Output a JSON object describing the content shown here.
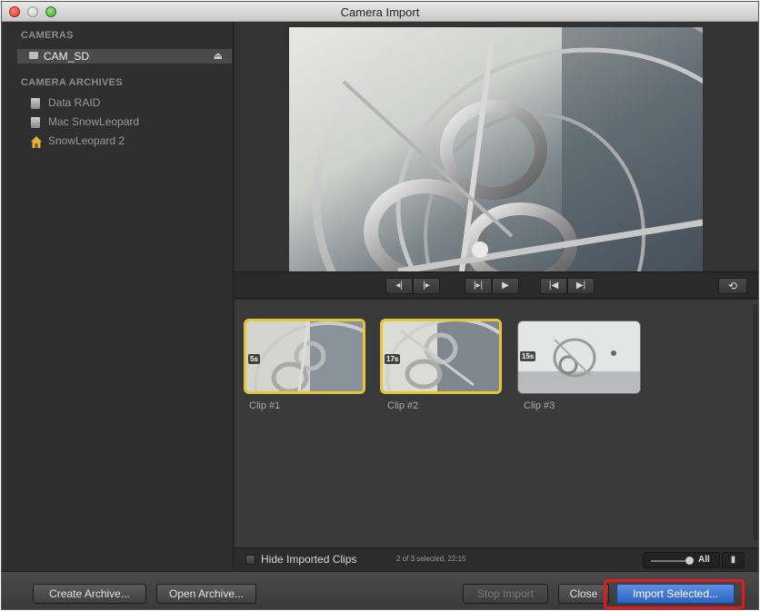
{
  "window": {
    "title": "Camera Import"
  },
  "sidebar": {
    "cameras_header": "CAMERAS",
    "cameras": [
      {
        "label": "CAM_SD",
        "icon": "camera-card-icon"
      }
    ],
    "archives_header": "CAMERA ARCHIVES",
    "archives": [
      {
        "label": "Data RAID",
        "icon": "drive-icon"
      },
      {
        "label": "Mac SnowLeopard",
        "icon": "drive-icon"
      },
      {
        "label": "SnowLeopard 2",
        "icon": "home-folder-icon"
      }
    ]
  },
  "transport": {
    "buttons": [
      "prev-frame-icon",
      "next-frame-icon",
      "go-to-start-icon",
      "play-icon",
      "previous-clip-icon",
      "next-clip-icon",
      "loop-icon"
    ]
  },
  "browser": {
    "clips": [
      {
        "label": "Clip #1",
        "duration": "5s",
        "selected": true
      },
      {
        "label": "Clip #2",
        "duration": "17s",
        "selected": true
      },
      {
        "label": "Clip #3",
        "duration": "15s",
        "selected": false
      }
    ]
  },
  "status": {
    "hide_imported_label": "Hide Imported Clips",
    "selection_info": "2 of 3 selected, 22:15",
    "zoom_label": "All"
  },
  "buttons": {
    "create_archive": "Create Archive...",
    "open_archive": "Open Archive...",
    "stop_import": "Stop Import",
    "close": "Close",
    "import_selected": "Import Selected..."
  },
  "colors": {
    "selection_border": "#e6c639",
    "primary_button": "#2d63c3",
    "annotation": "#e41a1a"
  }
}
